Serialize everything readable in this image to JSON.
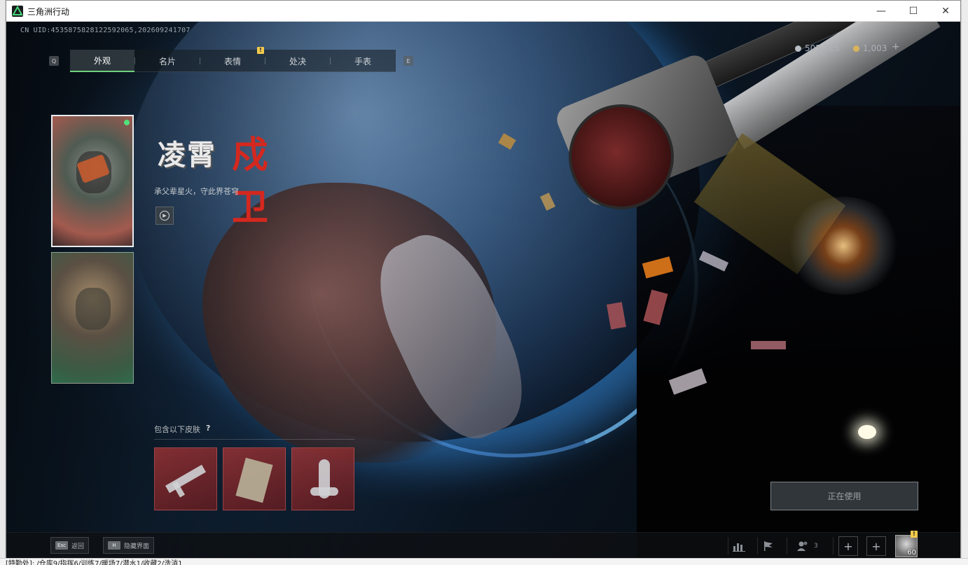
{
  "desktop": {
    "bottom_text": "[特勤处]: /仓库9/指挥6/训练7/暖场7/潜水1/收藏2/洗消1"
  },
  "window": {
    "title": "三角洲行动",
    "minimize_glyph": "—",
    "maximize_glyph": "☐",
    "close_glyph": "✕"
  },
  "game": {
    "uid": "CN UID:4535875828122592065,202609241707",
    "tabs": [
      {
        "label": "外观",
        "active": true
      },
      {
        "label": "名片",
        "active": false
      },
      {
        "label": "表情",
        "active": false
      },
      {
        "label": "处决",
        "active": false
      },
      {
        "label": "手表",
        "active": false
      }
    ],
    "tab_prev_key": "Q",
    "tab_next_key": "E",
    "tab_badge": "!",
    "currency": {
      "silver": "505,215",
      "gold": "1,003",
      "plus": "+",
      "silver_color": "#b9bfc4",
      "gold_color": "#d9b35c"
    },
    "skin": {
      "logo_text": "凌霄",
      "logo_accent": "戍卫",
      "description": "承父辈星火，守此界苍穹"
    },
    "includes": {
      "label": "包含以下皮肤",
      "help": "?"
    },
    "in_use_label": "正在使用",
    "bottom": {
      "hints": [
        {
          "key": "Esc",
          "label": "返回"
        },
        {
          "key": "H",
          "label": "隐藏界面"
        }
      ],
      "friends_count": "3",
      "plus": "+",
      "avatar_level": "60",
      "avatar_badge": "!"
    },
    "accent_color": "#6fd17c"
  }
}
